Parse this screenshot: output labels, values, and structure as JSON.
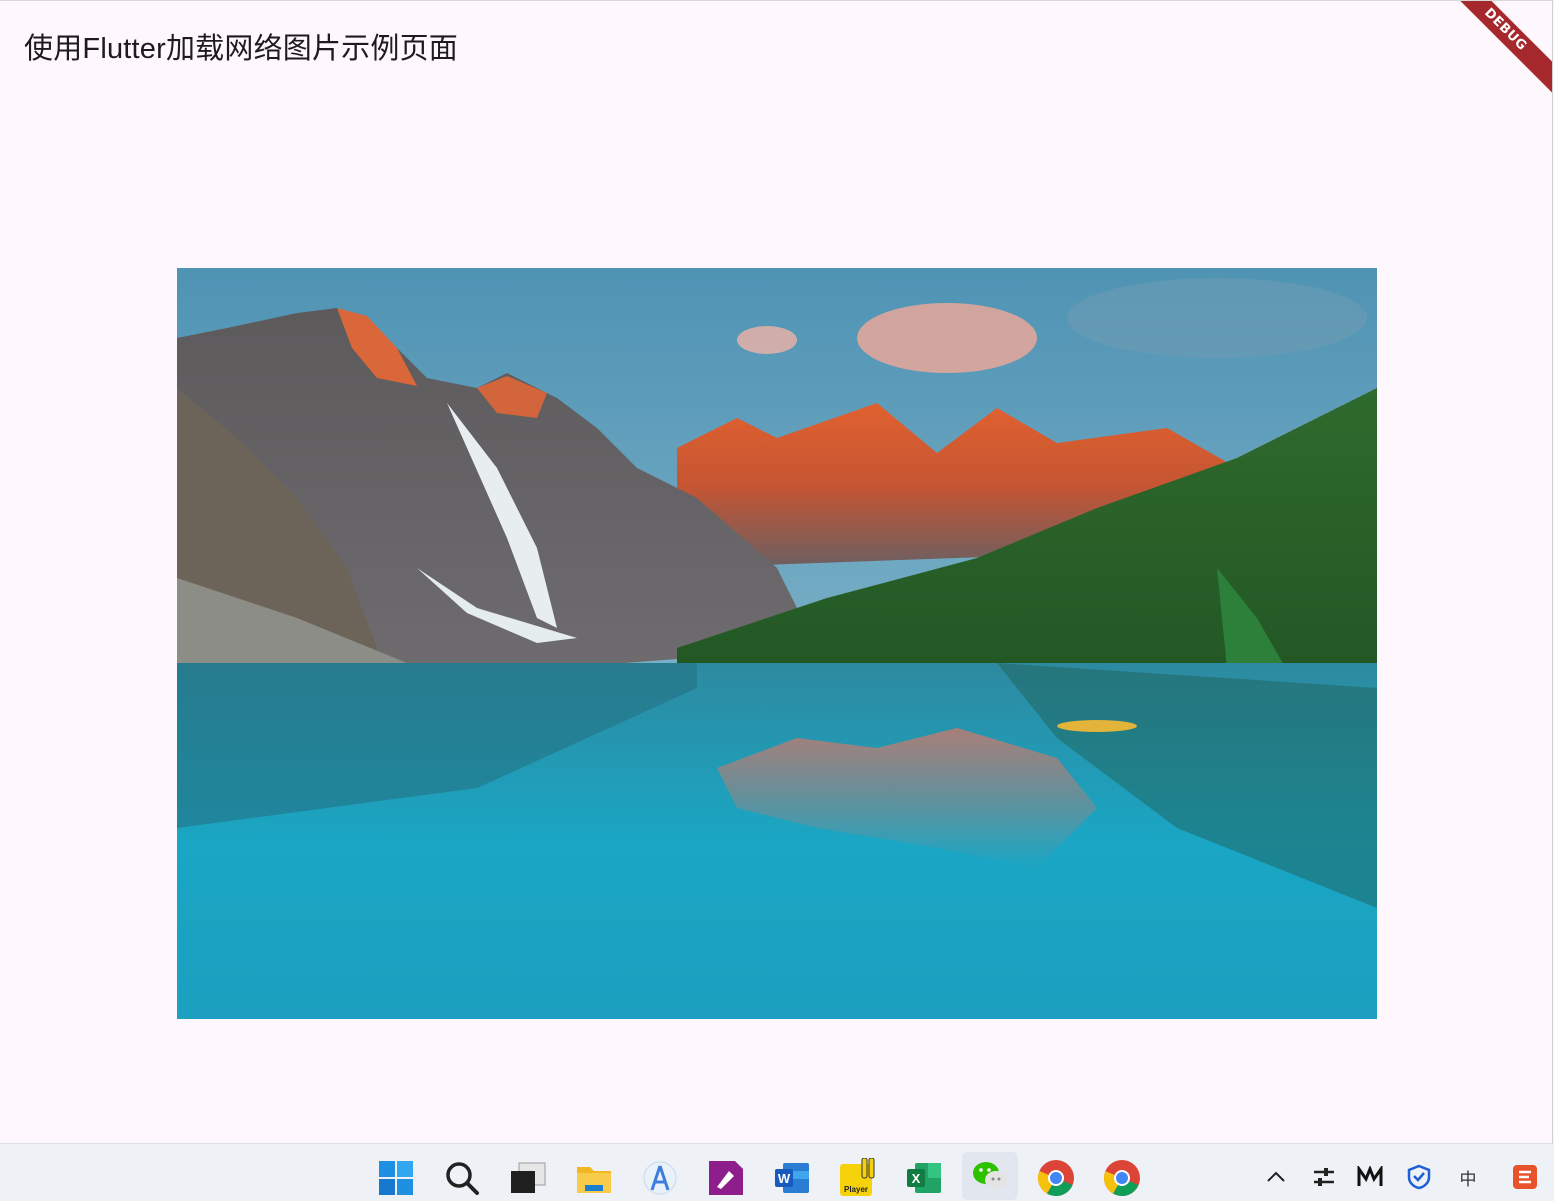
{
  "app": {
    "title": "使用Flutter加载网络图片示例页面",
    "debug_banner": "DEBUG"
  },
  "image": {
    "subject": "mountain-lake-landscape"
  },
  "taskbar": {
    "apps": [
      {
        "name": "windows-start",
        "icon": "windows-logo-icon"
      },
      {
        "name": "search",
        "icon": "search-icon"
      },
      {
        "name": "task-view",
        "icon": "task-view-icon"
      },
      {
        "name": "file-explorer",
        "icon": "folder-icon"
      },
      {
        "name": "android-studio",
        "icon": "android-studio-icon"
      },
      {
        "name": "pen-app",
        "icon": "pen-icon"
      },
      {
        "name": "word",
        "icon": "word-icon",
        "label": "W"
      },
      {
        "name": "player",
        "icon": "player-icon",
        "label": "Player"
      },
      {
        "name": "excel",
        "icon": "excel-icon",
        "label": "X"
      },
      {
        "name": "wechat",
        "icon": "wechat-icon"
      },
      {
        "name": "chrome",
        "icon": "chrome-icon"
      },
      {
        "name": "chrome-2",
        "icon": "chrome-icon"
      }
    ],
    "tray": {
      "ime_label": "中"
    }
  },
  "colors": {
    "background": "#fef7fe",
    "debug_banner": "#a5282c",
    "taskbar": "#eef1f6"
  }
}
